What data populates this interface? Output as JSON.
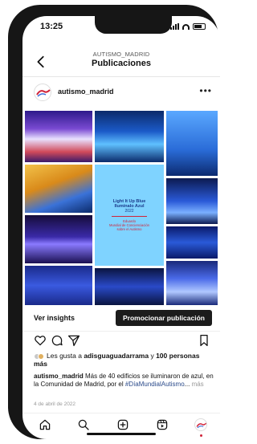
{
  "status_bar": {
    "time": "13:25"
  },
  "header": {
    "account": "AUTISMO_MADRID",
    "title": "Publicaciones"
  },
  "post": {
    "username": "autismo_madrid",
    "poster": {
      "line1": "Light It Up Blue",
      "line2": "Ilumínalo Azul",
      "line3": "2022",
      "line4": "Eduardo",
      "line5": "Mundial de Concienciación",
      "line6": "sobre el Autismo"
    },
    "insights_label": "Ver insights",
    "promote_label": "Promocionar publicación",
    "likes": {
      "prefix": "Les gusta a ",
      "user": "adisguaguadarrama",
      "connector": " y ",
      "others": "100 personas más"
    },
    "caption": {
      "username": "autismo_madrid",
      "text": " Más de 40 edificios se iluminaron de azul, en la Comunidad de Madrid, por el ",
      "hashtag": "#DíaMundialAutismo",
      "ellipsis": "...",
      "more": "más"
    },
    "date": "4 de abril de 2022"
  },
  "tab_bar": {
    "items": [
      "home-icon",
      "search-icon",
      "add-icon",
      "reels-icon",
      "profile-icon"
    ]
  },
  "colors": {
    "background": "#ffffff",
    "text": "#111111",
    "promote_button": "#1c1c1c",
    "hashtag": "#2a4a8a",
    "secondary_text": "#999999",
    "accent_red": "#d0243a"
  }
}
